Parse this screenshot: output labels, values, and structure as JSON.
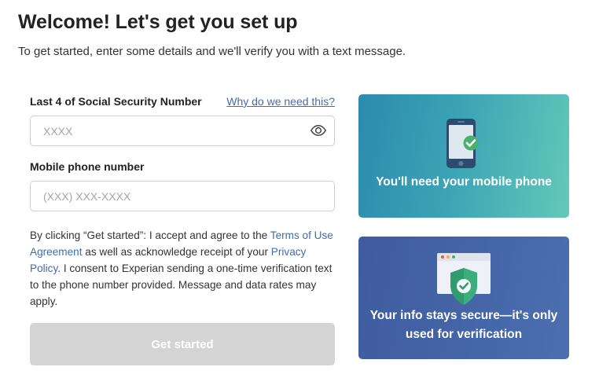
{
  "header": {
    "title": "Welcome! Let's get you set up",
    "subtitle": "To get started, enter some details and we'll verify you with a text message."
  },
  "form": {
    "ssn": {
      "label": "Last 4 of Social Security Number",
      "help_link": "Why do we need this?",
      "placeholder": "XXXX",
      "value": "",
      "toggle_icon": "eye-icon"
    },
    "phone": {
      "label": "Mobile phone number",
      "placeholder": "(XXX) XXX-XXXX",
      "value": ""
    },
    "consent": {
      "part1": "By clicking “Get started”: I accept and agree to the ",
      "terms_link": "Terms of Use Agreement",
      "part2": " as well as acknowledge receipt of your ",
      "privacy_link": "Privacy Policy",
      "part3": ". I consent to Experian sending a one-time verification text to the phone number provided. Message and data rates may apply."
    },
    "submit_label": "Get started"
  },
  "cards": {
    "phone": {
      "text": "You'll need your mobile phone",
      "icon": "mobile-phone-check-icon"
    },
    "secure": {
      "text": "Your info stays secure—it's only used for verification",
      "icon": "browser-shield-check-icon"
    }
  },
  "colors": {
    "link": "#426da9",
    "button_disabled": "#d4d4d4",
    "card_phone_start": "#2c8bac",
    "card_phone_end": "#64c8b8",
    "card_secure": "#4566a8",
    "check_green": "#4caf6e"
  }
}
